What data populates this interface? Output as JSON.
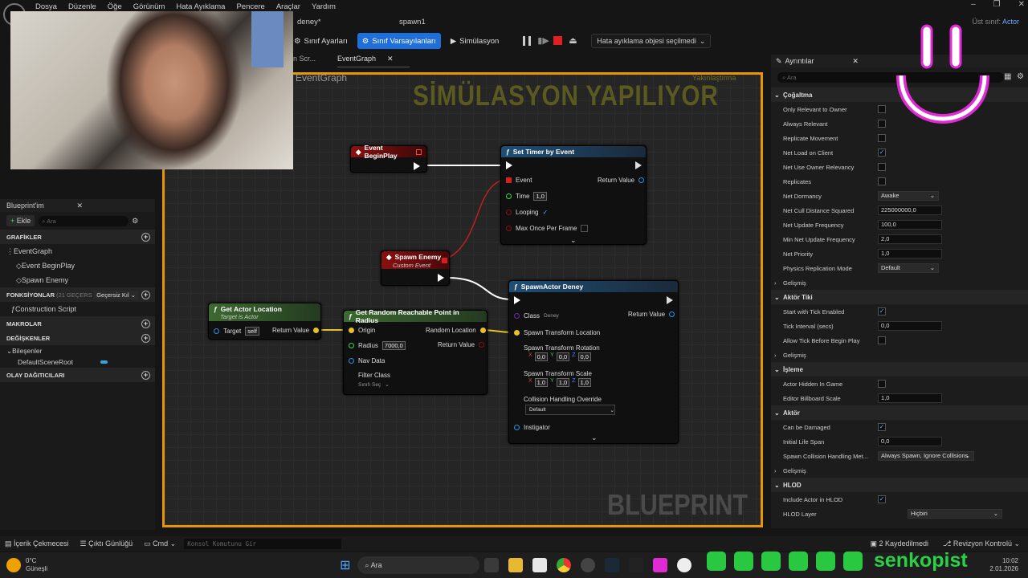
{
  "menu": [
    "Dosya",
    "Düzenle",
    "Öğe",
    "Görünüm",
    "Hata Ayıklama",
    "Pencere",
    "Araçlar",
    "Yardım"
  ],
  "parent_class": {
    "label": "Üst sınıf:",
    "value": "Actor"
  },
  "doc_tabs": [
    "deney*",
    "spawn1"
  ],
  "toolbar": {
    "class_settings": "Sınıf Ayarları",
    "class_defaults": "Sınıf Varsayılanları",
    "simulation": "Simülasyon",
    "debug_object": "Hata ayıklama objesi seçilmedi"
  },
  "graph": {
    "tab_prev": "on Scr...",
    "tab": "EventGraph",
    "title": "EventGraph",
    "overlay": "SİMÜLASYON YAPILIYOR",
    "overlay_small": "Yakınlaştırma",
    "watermark": "BLUEPRINT"
  },
  "nodes": {
    "begin_play": "Event BeginPlay",
    "set_timer": {
      "title": "Set Timer by Event",
      "event": "Event",
      "time": "Time",
      "time_val": "1,0",
      "looping": "Looping",
      "max_once": "Max Once Per Frame",
      "return": "Return Value"
    },
    "spawn_enemy": {
      "title": "Spawn Enemy",
      "sub": "Custom Event"
    },
    "get_actor": {
      "title": "Get Actor Location",
      "sub": "Target is Actor",
      "target": "Target",
      "self": "self",
      "return": "Return Value"
    },
    "random_point": {
      "title": "Get Random Reachable Point in Radius",
      "origin": "Origin",
      "radius": "Radius",
      "radius_val": "7000,0",
      "nav": "Nav Data",
      "filter": "Filter Class",
      "filter_val": "Sınıfı Seç",
      "rand_loc": "Random Location",
      "return": "Return Value"
    },
    "spawn_actor": {
      "title": "SpawnActor Deney",
      "class": "Class",
      "class_val": "Deney",
      "return": "Return Value",
      "stl": "Spawn Transform Location",
      "str": "Spawn Transform Rotation",
      "rot": [
        "0,0",
        "0,0",
        "0,0"
      ],
      "sts": "Spawn Transform Scale",
      "scale": [
        "1,0",
        "1,0",
        "1,0"
      ],
      "coll": "Collision Handling Override",
      "coll_val": "Default",
      "instigator": "Instigator"
    }
  },
  "left_panel": {
    "title": "Blueprint'im",
    "add": "Ekle",
    "search": "Ara",
    "graphs": "GRAFİKLER",
    "eventgraph": "EventGraph",
    "beginplay": "Event BeginPlay",
    "spawnenemy": "Spawn Enemy",
    "functions": "FONKSİYONLAR",
    "functions_count": "(21 GEÇERS",
    "override": "Geçersiz Kıl",
    "construction": "Construction Script",
    "macros": "MAKROLAR",
    "variables": "DEĞİŞKENLER",
    "components": "Bileşenler",
    "scene_root": "DefaultSceneRoot",
    "dispatchers": "OLAY DAĞITICILARI"
  },
  "details": {
    "title": "Ayrıntılar",
    "search": "Ara",
    "rows": [
      {
        "t": "sec",
        "l": "Çoğaltma"
      },
      {
        "t": "chk",
        "l": "Only Relevant to Owner",
        "v": false
      },
      {
        "t": "chk",
        "l": "Always Relevant",
        "v": false
      },
      {
        "t": "chk",
        "l": "Replicate Movement",
        "v": false
      },
      {
        "t": "chk",
        "l": "Net Load on Client",
        "v": true
      },
      {
        "t": "chk",
        "l": "Net Use Owner Relevancy",
        "v": false
      },
      {
        "t": "chk",
        "l": "Replicates",
        "v": false
      },
      {
        "t": "dd",
        "l": "Net Dormancy",
        "v": "Awake"
      },
      {
        "t": "in",
        "l": "Net Cull Distance Squared",
        "v": "225000000,0"
      },
      {
        "t": "in",
        "l": "Net Update Frequency",
        "v": "100,0"
      },
      {
        "t": "in",
        "l": "Min Net Update Frequency",
        "v": "2,0"
      },
      {
        "t": "in",
        "l": "Net Priority",
        "v": "1,0"
      },
      {
        "t": "dd",
        "l": "Physics Replication Mode",
        "v": "Default"
      },
      {
        "t": "exp",
        "l": "Gelişmiş"
      },
      {
        "t": "sec",
        "l": "Aktör Tiki"
      },
      {
        "t": "chk",
        "l": "Start with Tick Enabled",
        "v": true
      },
      {
        "t": "in",
        "l": "Tick Interval (secs)",
        "v": "0,0"
      },
      {
        "t": "chk",
        "l": "Allow Tick Before Begin Play",
        "v": false
      },
      {
        "t": "exp",
        "l": "Gelişmiş"
      },
      {
        "t": "sec",
        "l": "İşleme"
      },
      {
        "t": "chk",
        "l": "Actor Hidden In Game",
        "v": false
      },
      {
        "t": "in",
        "l": "Editor Billboard Scale",
        "v": "1,0"
      },
      {
        "t": "sec",
        "l": "Aktör"
      },
      {
        "t": "chk",
        "l": "Can be Damaged",
        "v": true
      },
      {
        "t": "in",
        "l": "Initial Life Span",
        "v": "0,0"
      },
      {
        "t": "dd",
        "l": "Spawn Collision Handling Met...",
        "v": "Always Spawn, Ignore Collisions"
      },
      {
        "t": "exp",
        "l": "Gelişmiş"
      },
      {
        "t": "sec",
        "l": "HLOD"
      },
      {
        "t": "chk",
        "l": "Include Actor in HLOD",
        "v": true
      },
      {
        "t": "dd",
        "l": "HLOD Layer",
        "v": "Hiçbiri"
      }
    ]
  },
  "bottom": {
    "content_browser": "İçerik Çekmecesi",
    "output_log": "Çıktı Günlüğü",
    "cmd": "Cmd",
    "console": "Konsol Komutunu Gir",
    "saved": "2 Kaydedilmedi",
    "revision": "Revizyon Kontrolü"
  },
  "taskbar": {
    "temp": "0°C",
    "weather": "Güneşli",
    "search": "Ara",
    "time": "10:02",
    "date": "2.01.2026"
  },
  "social_name": "senkopist"
}
